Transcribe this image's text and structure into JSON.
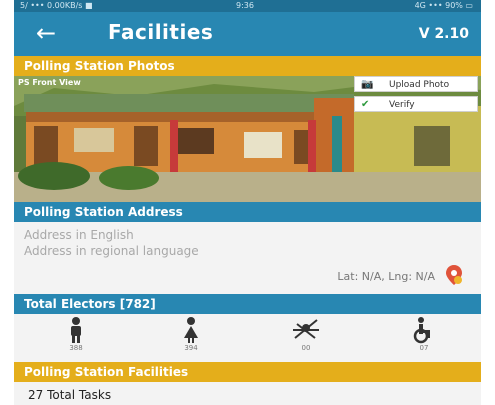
{
  "status_bar": {
    "left": "5∕ ••• 0.00KB/s ■",
    "time": "9:36",
    "right": "4G ••• 90% ▭"
  },
  "app_bar": {
    "back_icon": "back-arrow-icon",
    "title": "Facilities",
    "version": "V 2.10"
  },
  "photos_section": {
    "header": "Polling Station Photos",
    "caption": "PS Front View",
    "update_photo_label": "Upload Photo",
    "verify_label": "Verify"
  },
  "address_section": {
    "header": "Polling Station Address",
    "address_english": "Address in English",
    "address_regional": "Address in regional language",
    "latlng": "Lat: N/A, Lng: N/A"
  },
  "electors_section": {
    "header": "Total Electors [782]",
    "items": [
      {
        "icon": "male-icon",
        "count": "388"
      },
      {
        "icon": "female-icon",
        "count": "394"
      },
      {
        "icon": "third-gender-icon",
        "count": "00"
      },
      {
        "icon": "wheelchair-icon",
        "count": "07"
      }
    ]
  },
  "facilities_section": {
    "header": "Polling Station Facilities",
    "total_tasks": "27 Total Tasks"
  },
  "colors": {
    "primary": "#2887b2",
    "accent": "#e4ae1b",
    "background": "#f3f3f3"
  }
}
